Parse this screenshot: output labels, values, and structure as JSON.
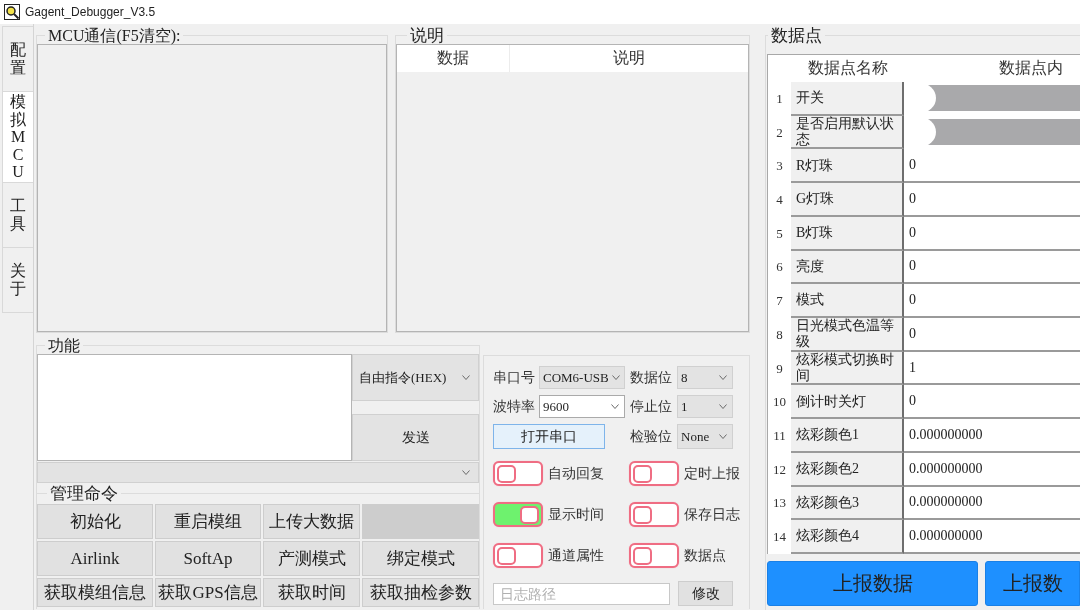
{
  "window": {
    "title": "Gagent_Debugger_V3.5"
  },
  "side_tabs": [
    {
      "label": "配置",
      "selected": false
    },
    {
      "label": "模拟MCU",
      "selected": true
    },
    {
      "label": "工具",
      "selected": false
    },
    {
      "label": "关于",
      "selected": false
    }
  ],
  "mcu_log": {
    "title": "MCU通信(F5清空):"
  },
  "description": {
    "title": "说明",
    "columns": [
      "数据",
      "说明"
    ]
  },
  "functions": {
    "title": "功能",
    "command_type": "自由指令(HEX)",
    "send_button": "发送",
    "management": {
      "title": "管理命令",
      "rows": [
        [
          "初始化",
          "重启模组",
          "上传大数据"
        ],
        [
          "Airlink",
          "SoftAp",
          "产测模式",
          "绑定模式"
        ],
        [
          "获取模组信息",
          "获取GPS信息",
          "获取时间",
          "获取抽检参数"
        ]
      ]
    }
  },
  "serial": {
    "left_fields": [
      {
        "label": "串口号",
        "value": "COM6-USB",
        "editable": false
      },
      {
        "label": "波特率",
        "value": "9600",
        "editable": true
      }
    ],
    "open_button": "打开串口",
    "right_fields": [
      {
        "label": "数据位",
        "value": "8",
        "editable": false
      },
      {
        "label": "停止位",
        "value": "1",
        "editable": false
      },
      {
        "label": "检验位",
        "value": "None",
        "editable": false
      }
    ],
    "options": [
      {
        "label": "自动回复",
        "on": false
      },
      {
        "label": "定时上报",
        "on": false
      },
      {
        "label": "显示时间",
        "on": true
      },
      {
        "label": "保存日志",
        "on": false
      },
      {
        "label": "通道属性",
        "on": false
      },
      {
        "label": "数据点",
        "on": false
      }
    ],
    "log_path": {
      "placeholder": "日志路径",
      "button": "修改"
    }
  },
  "data_points": {
    "title": "数据点",
    "columns": [
      "数据点名称",
      "数据点内"
    ],
    "rows": [
      {
        "index": "1",
        "name": "开关",
        "kind": "switch",
        "on": false
      },
      {
        "index": "2",
        "name": "是否启用默认状态",
        "kind": "switch",
        "on": false
      },
      {
        "index": "3",
        "name": "R灯珠",
        "kind": "value",
        "value": "0"
      },
      {
        "index": "4",
        "name": "G灯珠",
        "kind": "value",
        "value": "0"
      },
      {
        "index": "5",
        "name": "B灯珠",
        "kind": "value",
        "value": "0"
      },
      {
        "index": "6",
        "name": "亮度",
        "kind": "value",
        "value": "0"
      },
      {
        "index": "7",
        "name": "模式",
        "kind": "value",
        "value": "0"
      },
      {
        "index": "8",
        "name": "日光模式色温等级",
        "kind": "value",
        "value": "0"
      },
      {
        "index": "9",
        "name": "炫彩模式切换时间",
        "kind": "value",
        "value": "1"
      },
      {
        "index": "10",
        "name": "倒计时关灯",
        "kind": "value",
        "value": "0"
      },
      {
        "index": "11",
        "name": "炫彩颜色1",
        "kind": "value",
        "value": "0.000000000"
      },
      {
        "index": "12",
        "name": "炫彩颜色2",
        "kind": "value",
        "value": "0.000000000"
      },
      {
        "index": "13",
        "name": "炫彩颜色3",
        "kind": "value",
        "value": "0.000000000"
      },
      {
        "index": "14",
        "name": "炫彩颜色4",
        "kind": "value",
        "value": "0.000000000"
      }
    ]
  },
  "report_buttons": [
    "上报数据",
    "上报数"
  ]
}
